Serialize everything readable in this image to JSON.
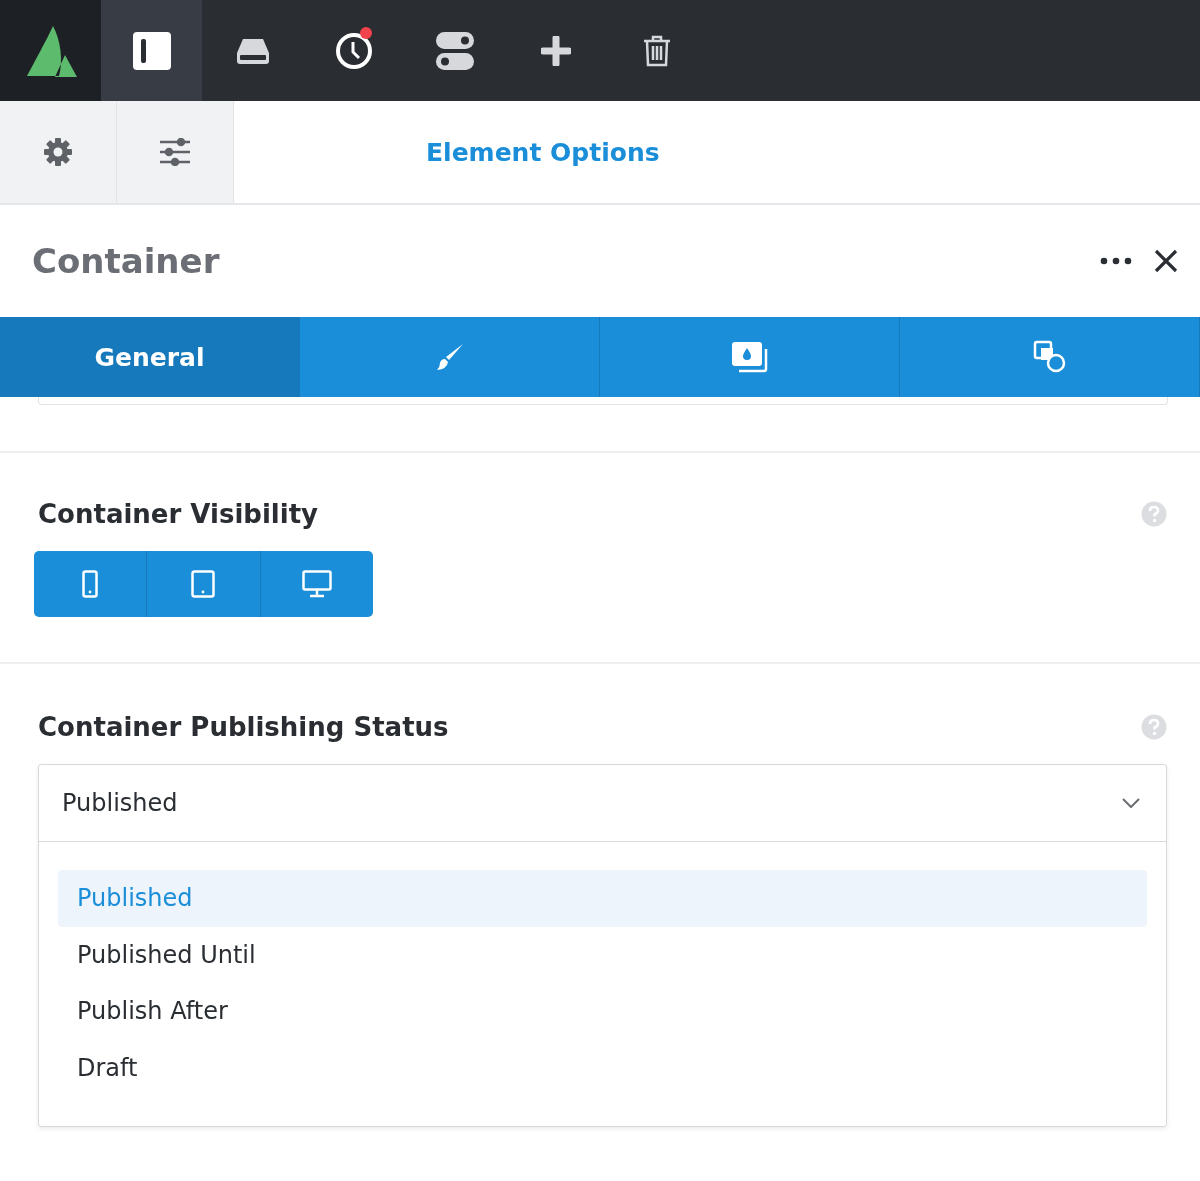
{
  "toolbar": {
    "items": [
      {
        "kind": "layout",
        "selected": true
      },
      {
        "kind": "drive",
        "selected": false
      },
      {
        "kind": "history",
        "selected": false,
        "notification": true
      },
      {
        "kind": "toggles",
        "selected": false
      },
      {
        "kind": "add",
        "selected": false
      },
      {
        "kind": "trash",
        "selected": false
      }
    ]
  },
  "panel_header": {
    "buttons": [
      {
        "kind": "settings"
      },
      {
        "kind": "sliders"
      }
    ],
    "title": "Element Options"
  },
  "element": {
    "title": "Container"
  },
  "tabs": [
    {
      "kind": "text",
      "label": "General",
      "selected": true
    },
    {
      "kind": "brush",
      "selected": false
    },
    {
      "kind": "image",
      "selected": false
    },
    {
      "kind": "shapes",
      "selected": false
    }
  ],
  "visibility": {
    "label": "Container Visibility",
    "devices": [
      {
        "kind": "phone",
        "on": true
      },
      {
        "kind": "tablet",
        "on": true
      },
      {
        "kind": "desktop",
        "on": true
      }
    ]
  },
  "publishing": {
    "label": "Container Publishing Status",
    "value": "Published",
    "options": [
      {
        "label": "Published",
        "selected": true
      },
      {
        "label": "Published Until",
        "selected": false
      },
      {
        "label": "Publish After",
        "selected": false
      },
      {
        "label": "Draft",
        "selected": false
      }
    ]
  }
}
